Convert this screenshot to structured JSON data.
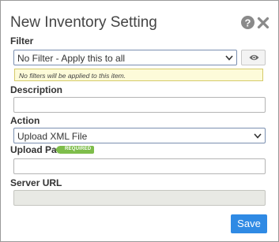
{
  "dialog": {
    "title": "New Inventory Setting",
    "help_icon": "question-icon",
    "close_icon": "close-icon"
  },
  "filter": {
    "label": "Filter",
    "selected": "No Filter - Apply this to all",
    "view_icon": "eye-icon",
    "note": "No filters will be applied to this item."
  },
  "description": {
    "label": "Description",
    "value": ""
  },
  "action": {
    "label": "Action",
    "selected": "Upload XML File"
  },
  "upload_path": {
    "label": "Upload Path",
    "required_badge": "REQUIRED",
    "value": ""
  },
  "server_url": {
    "label": "Server URL",
    "value": ""
  },
  "footer": {
    "save_label": "Save"
  },
  "colors": {
    "save_button": "#2f8ae4",
    "required_badge": "#7ebd4b",
    "note_background": "#fdfbd9"
  }
}
